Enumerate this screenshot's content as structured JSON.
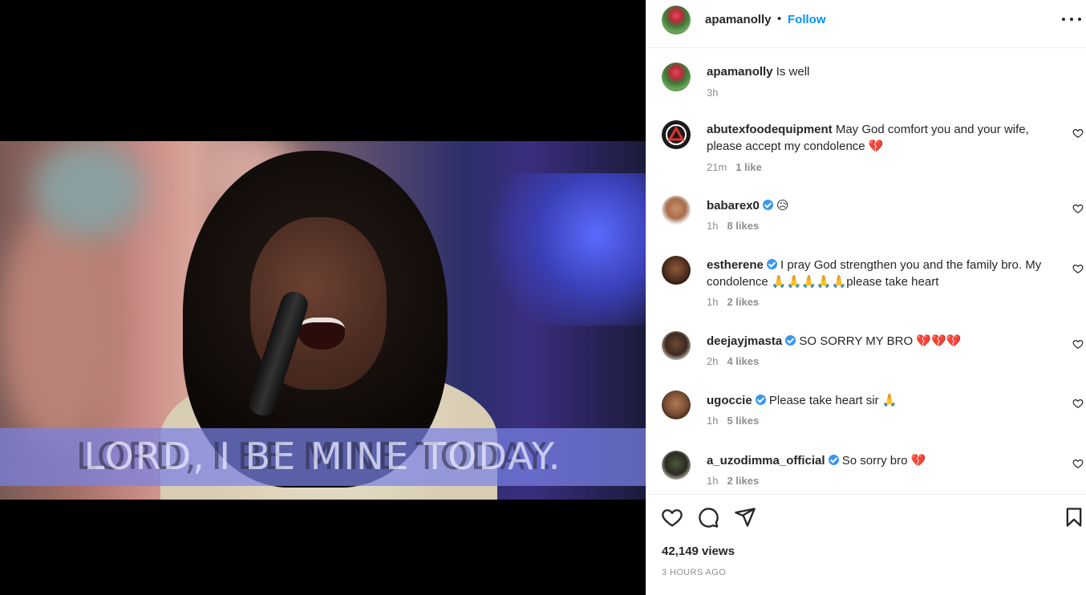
{
  "media": {
    "lyric": "LORD, I BE MINE TODAY."
  },
  "header": {
    "username": "apamanolly",
    "separator": "•",
    "follow_label": "Follow",
    "more_icon": "more-horizontal-icon"
  },
  "caption": {
    "username": "apamanolly",
    "text": "Is well",
    "time": "3h"
  },
  "comments": [
    {
      "username": "abutexfoodequipment",
      "verified": false,
      "text": "May God comfort you and your wife, please accept my condolence",
      "emoji": "💔",
      "time": "21m",
      "likes": "1 like"
    },
    {
      "username": "babarex0",
      "verified": true,
      "text": "",
      "emoji": "😥",
      "time": "1h",
      "likes": "8 likes"
    },
    {
      "username": "estherene",
      "verified": true,
      "text": "I pray God strengthen you and the family bro. My condolence",
      "emoji": "🙏🙏🙏🙏🙏",
      "text_after": "please take heart",
      "time": "1h",
      "likes": "2 likes"
    },
    {
      "username": "deejayjmasta",
      "verified": true,
      "text": "SO SORRY MY BRO",
      "emoji": "💔💔💔",
      "time": "2h",
      "likes": "4 likes"
    },
    {
      "username": "ugoccie",
      "verified": true,
      "text": "Please take heart sir",
      "emoji": "🙏",
      "time": "1h",
      "likes": "5 likes"
    },
    {
      "username": "a_uzodimma_official",
      "verified": true,
      "text": "So sorry bro",
      "emoji": "💔",
      "time": "1h",
      "likes": "2 likes"
    }
  ],
  "actions": {
    "views": "42,149 views",
    "posted": "3 HOURS AGO"
  }
}
